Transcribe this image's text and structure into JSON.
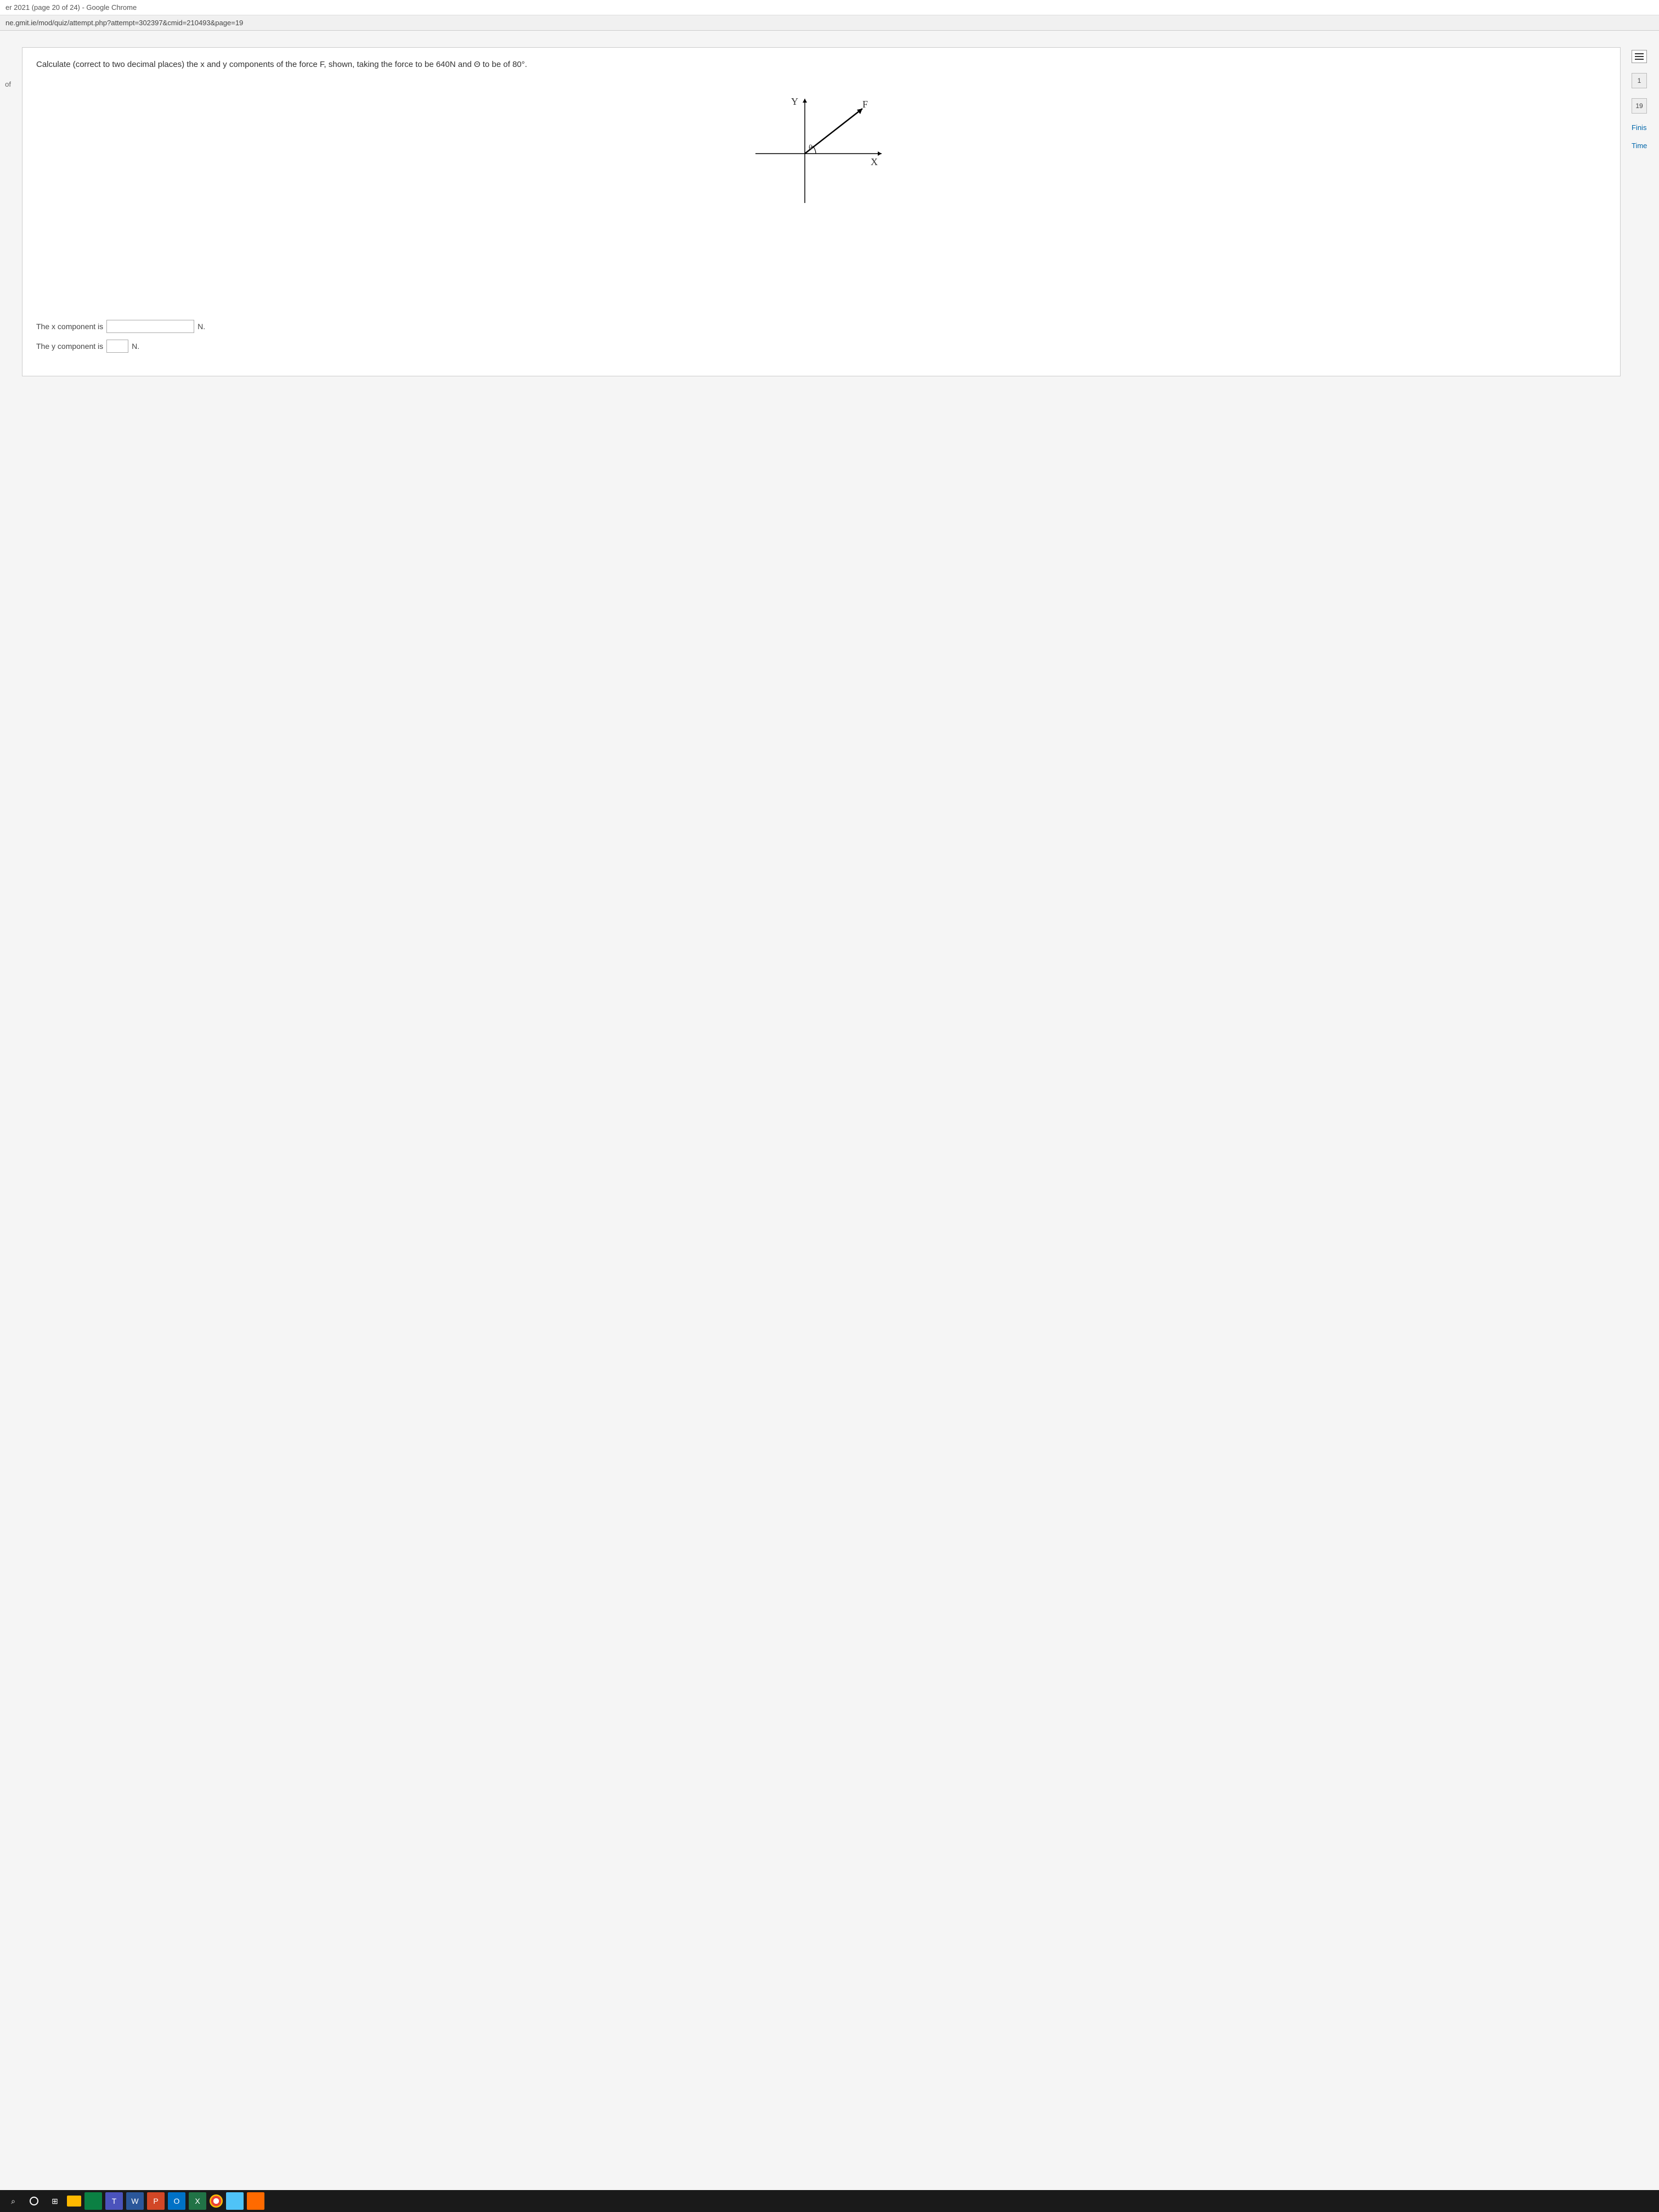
{
  "window": {
    "title": "er 2021 (page 20 of 24) - Google Chrome"
  },
  "url": "ne.gmit.ie/mod/quiz/attempt.php?attempt=302397&cmid=210493&page=19",
  "left_fragment": "of",
  "question": {
    "prompt": "Calculate (correct to two decimal places) the x and y components of the force F, shown, taking the force to be 640N and Θ to be of 80°.",
    "diagram": {
      "y_label": "Y",
      "f_label": "F",
      "x_label": "X",
      "theta_label": "θ"
    },
    "answers": {
      "x_label": "The x component is",
      "x_value": "",
      "x_unit": "N.",
      "y_label": "The y component is",
      "y_value": "",
      "y_unit": "N."
    }
  },
  "right": {
    "nav1": "1",
    "nav2": "19",
    "finish": "Finis",
    "time": "Time"
  },
  "taskbar": {
    "search": "⌕",
    "taskview": "⊞",
    "word": "W",
    "ppt": "P",
    "outlook": "O",
    "excel": "X",
    "teams": "T"
  }
}
